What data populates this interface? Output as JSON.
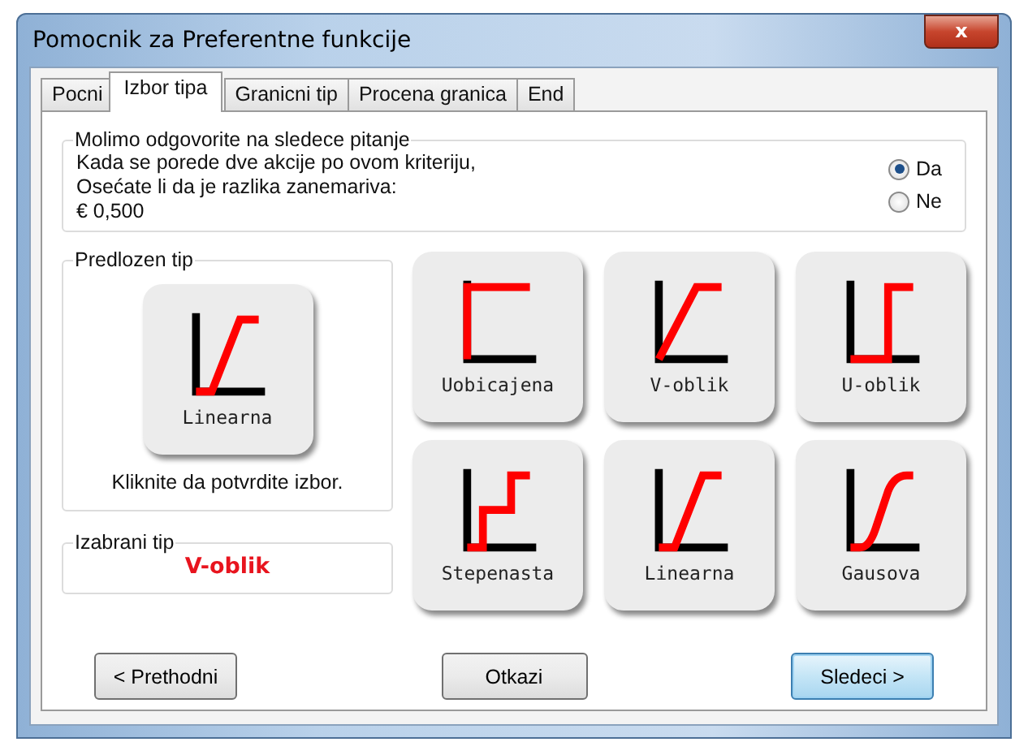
{
  "window": {
    "title": "Pomocnik za Preferentne funkcije",
    "close": "x"
  },
  "tabs": [
    {
      "label": "Pocni",
      "selected": false
    },
    {
      "label": "Izbor tipa",
      "selected": true
    },
    {
      "label": "Granicni tip",
      "selected": false
    },
    {
      "label": "Procena granica",
      "selected": false
    },
    {
      "label": "End",
      "selected": false
    }
  ],
  "question": {
    "legend": "Molimo odgovorite na sledece pitanje",
    "lines": [
      "Kada se porede dve akcije po ovom kriteriju,",
      "Osećate li da je razlika  zanemariva:",
      "€ 0,500"
    ],
    "options": [
      {
        "label": "Da",
        "selected": true
      },
      {
        "label": "Ne",
        "selected": false
      }
    ]
  },
  "suggested": {
    "legend": "Predlozen tip",
    "tile": {
      "label": "Linearna",
      "kind": "linear"
    },
    "hint": "Kliknite da potvrdite izbor."
  },
  "chosen": {
    "legend": "Izabrani tip",
    "value": "V-oblik"
  },
  "types": [
    {
      "label": "Uobicajena",
      "kind": "usual"
    },
    {
      "label": "V-oblik",
      "kind": "v"
    },
    {
      "label": "U-oblik",
      "kind": "u"
    },
    {
      "label": "Stepenasta",
      "kind": "stairs"
    },
    {
      "label": "Linearna",
      "kind": "linear"
    },
    {
      "label": "Gausova",
      "kind": "gauss"
    }
  ],
  "buttons": [
    {
      "label": "< Prethodni",
      "kind": "back"
    },
    {
      "label": "Otkazi",
      "kind": "cancel"
    },
    {
      "label": "Sledeci >",
      "kind": "next"
    }
  ]
}
